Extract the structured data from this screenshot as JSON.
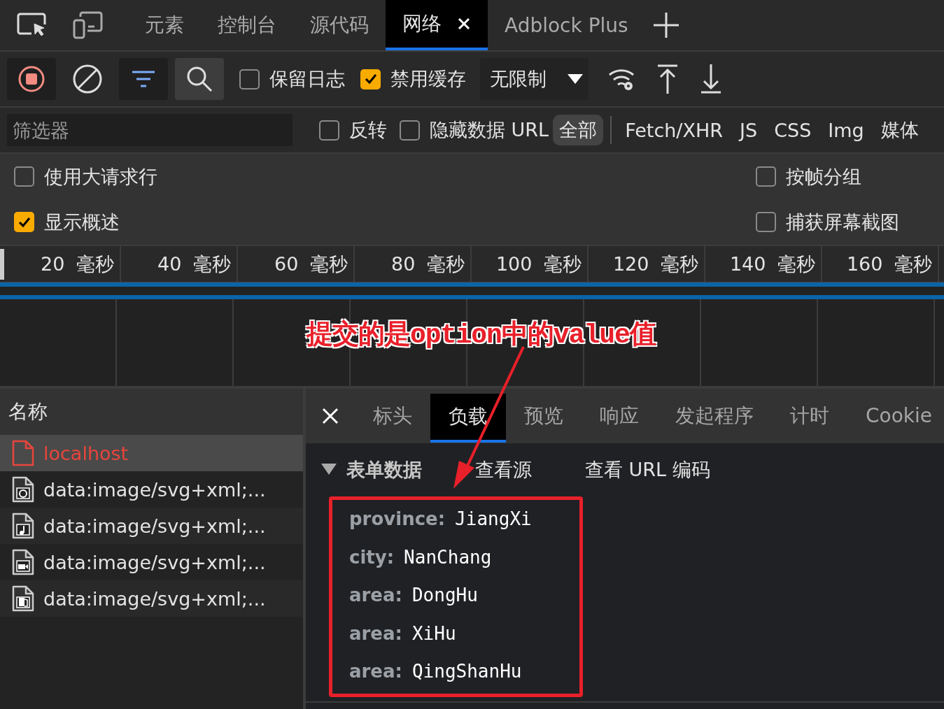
{
  "top_tabs": [
    {
      "label": "元素",
      "selected": false
    },
    {
      "label": "控制台",
      "selected": false
    },
    {
      "label": "源代码",
      "selected": false
    },
    {
      "label": "网络",
      "selected": true
    },
    {
      "label": "Adblock Plus",
      "selected": false
    }
  ],
  "toolbar": {
    "recording": true,
    "filter_shown": true,
    "search_shown": true,
    "checkboxes": [
      {
        "label": "保留日志",
        "checked": false
      },
      {
        "label": "禁用缓存",
        "checked": true
      }
    ],
    "throttle": "无限制"
  },
  "filter": {
    "placeholder": "筛选器",
    "checkboxes": [
      {
        "label": "反转",
        "checked": false
      },
      {
        "label": "隐藏数据 URL",
        "checked": false
      }
    ],
    "types": [
      {
        "label": "全部",
        "selected": true
      },
      {
        "label": "Fetch/XHR",
        "selected": false
      },
      {
        "label": "JS",
        "selected": false
      },
      {
        "label": "CSS",
        "selected": false
      },
      {
        "label": "Img",
        "selected": false
      },
      {
        "label": "媒体",
        "selected": false
      }
    ]
  },
  "options": [
    {
      "label": "使用大请求行",
      "checked": false
    },
    {
      "label": "按帧分组",
      "checked": false
    },
    {
      "label": "显示概述",
      "checked": true
    },
    {
      "label": "捕获屏幕截图",
      "checked": false
    }
  ],
  "timeline": {
    "ticks": [
      "20 毫秒",
      "40 毫秒",
      "60 毫秒",
      "80 毫秒",
      "100 毫秒",
      "120 毫秒",
      "140 毫秒",
      "160 毫秒"
    ]
  },
  "requests": {
    "header": "名称",
    "rows": [
      {
        "name": "localhost",
        "kind": "document",
        "selected": true,
        "failed": true
      },
      {
        "name": "data:image/svg+xml;...",
        "kind": "web",
        "selected": false,
        "failed": false
      },
      {
        "name": "data:image/svg+xml;...",
        "kind": "audio",
        "selected": false,
        "failed": false
      },
      {
        "name": "data:image/svg+xml;...",
        "kind": "video",
        "selected": false,
        "failed": false
      },
      {
        "name": "data:image/svg+xml;...",
        "kind": "pages",
        "selected": false,
        "failed": false
      }
    ]
  },
  "details": {
    "tabs": [
      {
        "label": "标头",
        "selected": false
      },
      {
        "label": "负载",
        "selected": true
      },
      {
        "label": "预览",
        "selected": false
      },
      {
        "label": "响应",
        "selected": false
      },
      {
        "label": "发起程序",
        "selected": false
      },
      {
        "label": "计时",
        "selected": false
      },
      {
        "label": "Cookie",
        "selected": false
      }
    ],
    "section": {
      "title": "表单数据",
      "expanded": true,
      "links": [
        "查看源",
        "查看 URL 编码"
      ]
    },
    "fields": [
      {
        "key": "province:",
        "value": "JiangXi"
      },
      {
        "key": "city:",
        "value": "NanChang"
      },
      {
        "key": "area:",
        "value": "DongHu"
      },
      {
        "key": "area:",
        "value": "XiHu"
      },
      {
        "key": "area:",
        "value": "QingShanHu"
      }
    ]
  },
  "annotation": {
    "text": "提交的是option中的value值"
  }
}
